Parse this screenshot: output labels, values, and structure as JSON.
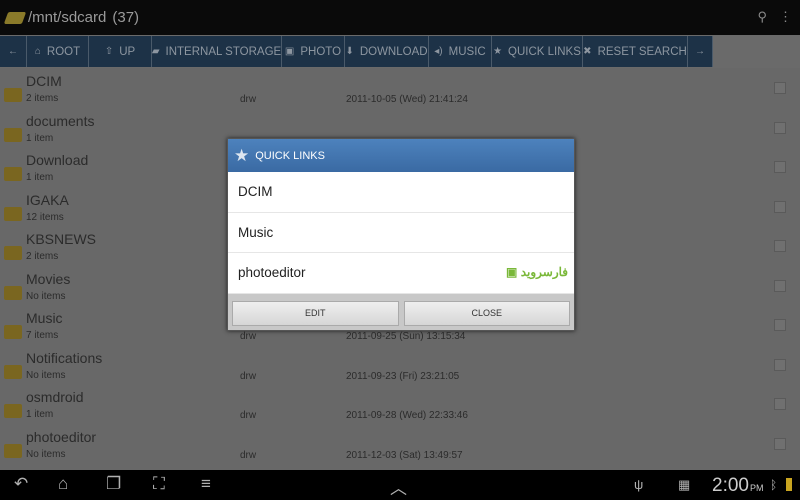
{
  "title": {
    "path": "/mnt/sdcard",
    "count": "(37)",
    "search_icon": "search-icon",
    "menu_icon": "overflow-menu-icon"
  },
  "toolbar": [
    {
      "label": "",
      "icon": "←"
    },
    {
      "label": "ROOT",
      "icon": "⌂"
    },
    {
      "label": "UP",
      "icon": "⇧"
    },
    {
      "label": "INTERNAL STORAGE",
      "icon": "▰"
    },
    {
      "label": "PHOTO",
      "icon": "▣"
    },
    {
      "label": "DOWNLOAD",
      "icon": "⬇"
    },
    {
      "label": "MUSIC",
      "icon": "◂)"
    },
    {
      "label": "QUICK LINKS",
      "icon": "★"
    },
    {
      "label": "RESET SEARCH",
      "icon": "✖"
    },
    {
      "label": "",
      "icon": "→"
    }
  ],
  "files": [
    {
      "name": "DCIM",
      "sub": "2 items",
      "perm": "drw",
      "date": "2011-10-05 (Wed) 21:41:24"
    },
    {
      "name": "documents",
      "sub": "1 item",
      "perm": "",
      "date": ""
    },
    {
      "name": "Download",
      "sub": "1 item",
      "perm": "",
      "date": ""
    },
    {
      "name": "IGAKA",
      "sub": "12 items",
      "perm": "",
      "date": ""
    },
    {
      "name": "KBSNEWS",
      "sub": "2 items",
      "perm": "",
      "date": ""
    },
    {
      "name": "Movies",
      "sub": "No items",
      "perm": "",
      "date": ""
    },
    {
      "name": "Music",
      "sub": "7 items",
      "perm": "drw",
      "date": "2011-09-25 (Sun) 13:15:34"
    },
    {
      "name": "Notifications",
      "sub": "No items",
      "perm": "drw",
      "date": "2011-09-23 (Fri) 23:21:05"
    },
    {
      "name": "osmdroid",
      "sub": "1 item",
      "perm": "drw",
      "date": "2011-09-28 (Wed) 22:33:46"
    },
    {
      "name": "photoeditor",
      "sub": "No items",
      "perm": "drw",
      "date": "2011-12-03 (Sat) 13:49:57"
    }
  ],
  "dialog": {
    "title": "QUICK LINKS",
    "items": [
      "DCIM",
      "Music",
      "photoeditor"
    ],
    "edit": "EDIT",
    "close": "CLOSE",
    "watermark": "فارسروید"
  },
  "status": {
    "time": "2:00",
    "ampm": "PM"
  }
}
